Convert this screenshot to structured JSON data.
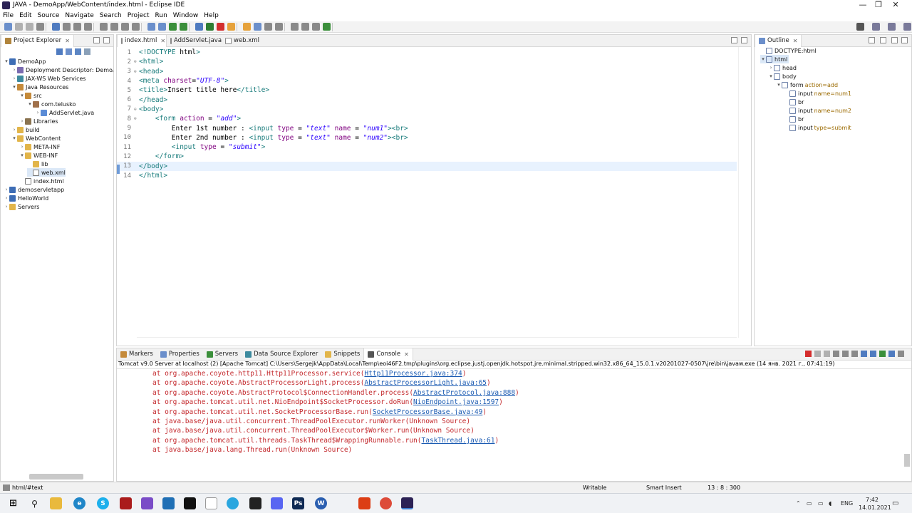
{
  "window": {
    "title": "JAVA - DemoApp/WebContent/index.html - Eclipse IDE",
    "minimize": "—",
    "maximize": "❐",
    "close": "✕"
  },
  "menu": [
    "File",
    "Edit",
    "Source",
    "Navigate",
    "Search",
    "Project",
    "Run",
    "Window",
    "Help"
  ],
  "project_explorer": {
    "tab_label": "Project Explorer",
    "tree": [
      {
        "label": "DemoApp",
        "depth": 0,
        "arrow": "▾",
        "icon": "project-icon"
      },
      {
        "label": "Deployment Descriptor: DemoApp",
        "depth": 1,
        "arrow": "›",
        "icon": "descriptor-icon"
      },
      {
        "label": "JAX-WS Web Services",
        "depth": 1,
        "arrow": "›",
        "icon": "webservice-icon"
      },
      {
        "label": "Java Resources",
        "depth": 1,
        "arrow": "▾",
        "icon": "java-resources-icon"
      },
      {
        "label": "src",
        "depth": 2,
        "arrow": "▾",
        "icon": "source-folder-icon"
      },
      {
        "label": "com.telusko",
        "depth": 3,
        "arrow": "▾",
        "icon": "package-icon"
      },
      {
        "label": "AddServlet.java",
        "depth": 4,
        "arrow": "›",
        "icon": "java-file-icon"
      },
      {
        "label": "Libraries",
        "depth": 2,
        "arrow": "›",
        "icon": "library-icon"
      },
      {
        "label": "build",
        "depth": 1,
        "arrow": "›",
        "icon": "folder-icon"
      },
      {
        "label": "WebContent",
        "depth": 1,
        "arrow": "▾",
        "icon": "folder-icon"
      },
      {
        "label": "META-INF",
        "depth": 2,
        "arrow": "›",
        "icon": "folder-icon"
      },
      {
        "label": "WEB-INF",
        "depth": 2,
        "arrow": "▾",
        "icon": "folder-icon"
      },
      {
        "label": "lib",
        "depth": 3,
        "arrow": "",
        "icon": "folder-icon"
      },
      {
        "label": "web.xml",
        "depth": 3,
        "arrow": "",
        "icon": "xml-file-icon",
        "selected": true
      },
      {
        "label": "index.html",
        "depth": 2,
        "arrow": "",
        "icon": "html-file-icon"
      },
      {
        "label": "demoservletapp",
        "depth": 0,
        "arrow": "›",
        "icon": "project-icon"
      },
      {
        "label": "HelloWorld",
        "depth": 0,
        "arrow": "›",
        "icon": "project-icon"
      },
      {
        "label": "Servers",
        "depth": 0,
        "arrow": "›",
        "icon": "folder-icon"
      }
    ]
  },
  "editor": {
    "tabs": [
      {
        "label": "index.html",
        "active": true,
        "close": "✕"
      },
      {
        "label": "AddServlet.java",
        "active": false
      },
      {
        "label": "web.xml",
        "active": false
      }
    ],
    "lines": [
      {
        "n": "1",
        "fold": "",
        "code": "<!DOCTYPE html>"
      },
      {
        "n": "2",
        "fold": "⊖",
        "code": "<html>"
      },
      {
        "n": "3",
        "fold": "⊖",
        "code": "<head>"
      },
      {
        "n": "4",
        "fold": "",
        "code": "<meta charset=\"UTF-8\">"
      },
      {
        "n": "5",
        "fold": "",
        "code": "<title>Insert title here</title>"
      },
      {
        "n": "6",
        "fold": "",
        "code": "</head>"
      },
      {
        "n": "7",
        "fold": "⊖",
        "code": "<body>"
      },
      {
        "n": "8",
        "fold": "⊖",
        "code": "    <form action = \"add\">"
      },
      {
        "n": "9",
        "fold": "",
        "code": "        Enter 1st number : <input type = \"text\" name = \"num1\"><br>"
      },
      {
        "n": "10",
        "fold": "",
        "code": "        Enter 2nd number : <input type = \"text\" name = \"num2\"><br>"
      },
      {
        "n": "11",
        "fold": "",
        "code": "        <input type = \"submit\">"
      },
      {
        "n": "12",
        "fold": "",
        "code": "    </form>"
      },
      {
        "n": "13",
        "fold": "",
        "code": "</body>",
        "current": true
      },
      {
        "n": "14",
        "fold": "",
        "code": "</html>"
      }
    ]
  },
  "outline": {
    "tab_label": "Outline",
    "tree": [
      {
        "label": "DOCTYPE:html",
        "attr": "",
        "depth": 0,
        "arrow": ""
      },
      {
        "label": "html",
        "attr": "",
        "depth": 0,
        "arrow": "▾",
        "selected": true
      },
      {
        "label": "head",
        "attr": "",
        "depth": 1,
        "arrow": "›"
      },
      {
        "label": "body",
        "attr": "",
        "depth": 1,
        "arrow": "▾"
      },
      {
        "label": "form",
        "attr": "action=add",
        "depth": 2,
        "arrow": "▾"
      },
      {
        "label": "input",
        "attr": "name=num1",
        "depth": 3,
        "arrow": ""
      },
      {
        "label": "br",
        "attr": "",
        "depth": 3,
        "arrow": ""
      },
      {
        "label": "input",
        "attr": "name=num2",
        "depth": 3,
        "arrow": ""
      },
      {
        "label": "br",
        "attr": "",
        "depth": 3,
        "arrow": ""
      },
      {
        "label": "input",
        "attr": "type=submit",
        "depth": 3,
        "arrow": ""
      }
    ]
  },
  "bottom_panel": {
    "tabs": [
      {
        "label": "Markers",
        "active": false
      },
      {
        "label": "Properties",
        "active": false
      },
      {
        "label": "Servers",
        "active": false
      },
      {
        "label": "Data Source Explorer",
        "active": false
      },
      {
        "label": "Snippets",
        "active": false
      },
      {
        "label": "Console",
        "active": true
      }
    ],
    "console_header": "Tomcat v9.0 Server at localhost (2) [Apache Tomcat] C:\\Users\\Sergejk\\AppData\\Local\\Temp\\eoi46F2.tmp\\plugins\\org.eclipse.justj.openjdk.hotspot.jre.minimal.stripped.win32.x86_64_15.0.1.v20201027-0507\\jre\\bin\\javaw.exe  (14 янв. 2021 г., 07:41:19)",
    "console_lines": [
      {
        "text": "at org.apache.coyote.http11.Http11Processor.service(",
        "link": "Http11Processor.java:374",
        "tail": ")"
      },
      {
        "text": "at org.apache.coyote.AbstractProcessorLight.process(",
        "link": "AbstractProcessorLight.java:65",
        "tail": ")"
      },
      {
        "text": "at org.apache.coyote.AbstractProtocol$ConnectionHandler.process(",
        "link": "AbstractProtocol.java:888",
        "tail": ")"
      },
      {
        "text": "at org.apache.tomcat.util.net.NioEndpoint$SocketProcessor.doRun(",
        "link": "NioEndpoint.java:1597",
        "tail": ")"
      },
      {
        "text": "at org.apache.tomcat.util.net.SocketProcessorBase.run(",
        "link": "SocketProcessorBase.java:49",
        "tail": ")"
      },
      {
        "text": "at java.base/java.util.concurrent.ThreadPoolExecutor.runWorker(Unknown Source)",
        "link": "",
        "tail": ""
      },
      {
        "text": "at java.base/java.util.concurrent.ThreadPoolExecutor$Worker.run(Unknown Source)",
        "link": "",
        "tail": ""
      },
      {
        "text": "at org.apache.tomcat.util.threads.TaskThread$WrappingRunnable.run(",
        "link": "TaskThread.java:61",
        "tail": ")"
      },
      {
        "text": "at java.base/java.lang.Thread.run(Unknown Source)",
        "link": "",
        "tail": ""
      }
    ]
  },
  "statusbar": {
    "path": "html/#text",
    "writable": "Writable",
    "insert_mode": "Smart Insert",
    "position": "13 : 8 : 300"
  },
  "taskbar": {
    "lang": "ENG",
    "time": "7:42",
    "date": "14.01.2021"
  }
}
